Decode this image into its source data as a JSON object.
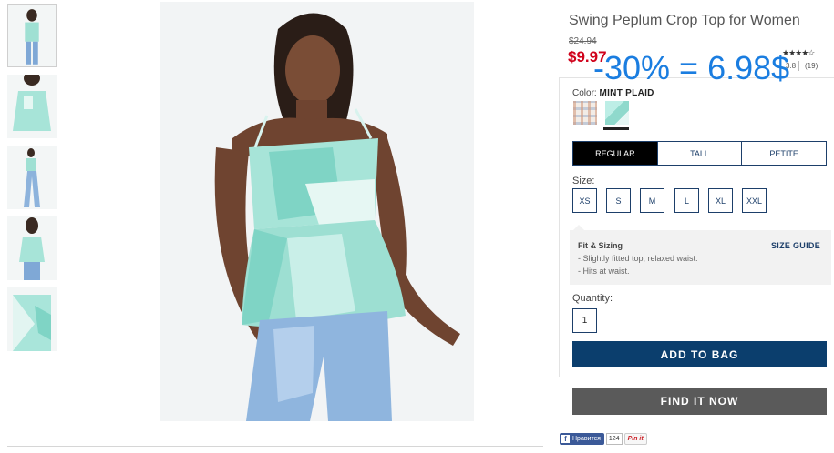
{
  "product": {
    "title": "Swing Peplum Crop Top for Women",
    "original_price": "$24.94",
    "sale_price": "$9.97",
    "overlay_note": "-30% = 6.98$",
    "stars_glyphs": "★★★★☆",
    "rating_value": "3.8",
    "review_count": "(19)"
  },
  "color": {
    "label": "Color:",
    "selected": "MINT PLAID",
    "swatches": [
      "plaid",
      "mint-plaid"
    ]
  },
  "fit_tabs": [
    "REGULAR",
    "TALL",
    "PETITE"
  ],
  "size": {
    "label": "Size:",
    "options": [
      "XS",
      "S",
      "M",
      "L",
      "XL",
      "XXL"
    ]
  },
  "fit_sizing": {
    "title": "Fit & Sizing",
    "lines": [
      "- Slightly fitted top; relaxed waist.",
      "- Hits at waist."
    ],
    "guide_link": "SIZE GUIDE"
  },
  "quantity": {
    "label": "Quantity:",
    "value": "1"
  },
  "actions": {
    "add_to_bag": "ADD TO BAG",
    "find_it_now": "FIND IT NOW"
  },
  "social": {
    "facebook_label": "Нравится",
    "facebook_count": "124",
    "pinterest_label": "Pin it"
  },
  "colors": {
    "sale_red": "#d0021b",
    "navy": "#0b3e6d",
    "overlay_blue": "#1a7de0",
    "mint": "#8fd9cc"
  }
}
